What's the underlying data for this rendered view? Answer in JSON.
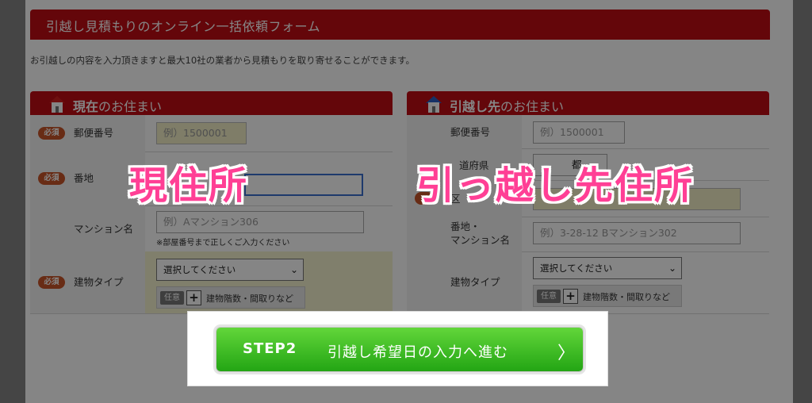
{
  "header": {
    "title": "引越し見積もりのオンライン一括依頼フォーム"
  },
  "intro": "お引越しの内容を入力頂きますと最大10社の業者から見積もりを取り寄せることができます。",
  "current": {
    "title_bold": "現在",
    "title_rest": "のお住まい",
    "required_badge": "必須",
    "postal_label": "郵便番号",
    "postal_placeholder": "例）1500001",
    "address_label": "番地",
    "mansion_label": "マンション名",
    "mansion_placeholder": "例）Aマンション306",
    "mansion_note": "※部屋番号まで正しくご入力ください",
    "building_label": "建物タイプ",
    "building_select": "選択してください",
    "optional_badge": "任意",
    "plus": "+",
    "floors_text": "建物階数・間取りなど"
  },
  "destination": {
    "title_bold": "引越し先",
    "title_rest": "のお住まい",
    "postal_label": "郵便番号",
    "postal_placeholder": "例）1500001",
    "prefecture_label": "道府県",
    "prefecture_value": "都",
    "city_label": "区",
    "address_label": "番地・\nマンション名",
    "address_placeholder": "例）3-28-12 Bマンション302",
    "building_label": "建物タイプ",
    "building_select": "選択してください",
    "optional_badge": "任意",
    "plus": "+",
    "floors_text": "建物階数・間取りなど"
  },
  "overlays": {
    "left": "現住所",
    "right": "引っ越し先住所"
  },
  "step_button": {
    "step": "STEP2",
    "label": "引越し希望日の入力へ進む",
    "arrow": "〉"
  },
  "colors": {
    "brand_red": "#c00d14",
    "overlay_pink": "#ff3f95",
    "step_green": "#3bbd22"
  }
}
